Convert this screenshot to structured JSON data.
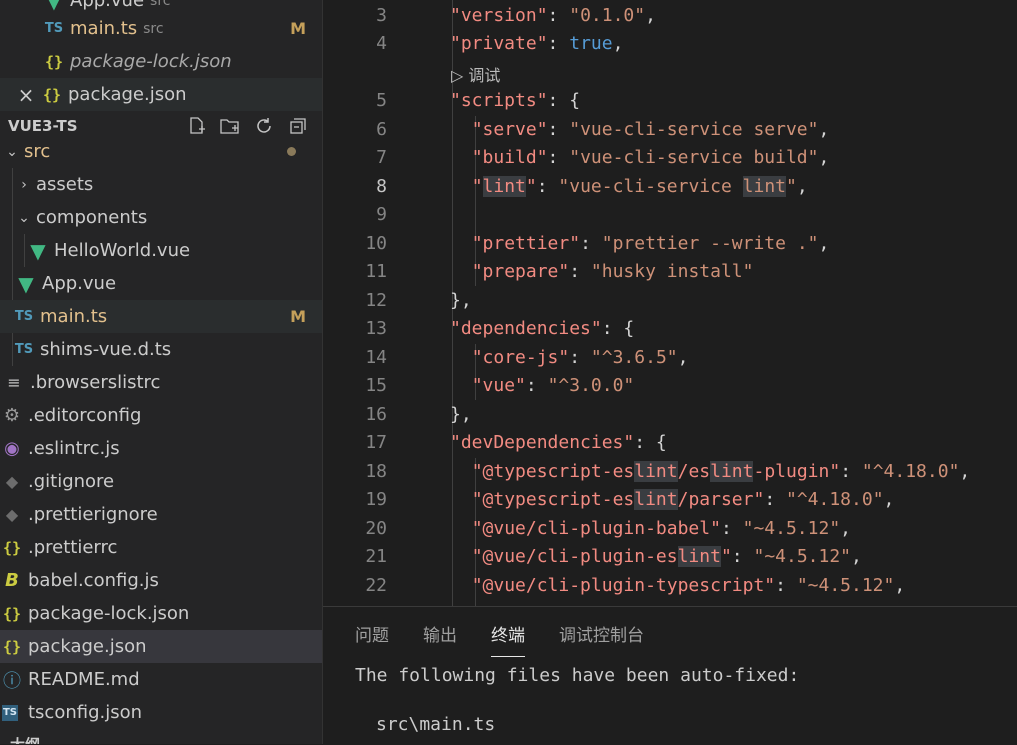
{
  "open_editors": [
    {
      "label": "App.vue",
      "desc": "src",
      "icon": "vue"
    },
    {
      "label": "main.ts",
      "desc": "src",
      "badge": "M",
      "icon": "ts"
    },
    {
      "label": "package-lock.json",
      "icon": "json"
    },
    {
      "label": "package.json",
      "icon": "json",
      "close": "×"
    }
  ],
  "explorer": {
    "title": "VUE3-TS",
    "items": [
      {
        "label": "src",
        "chev": "⌄"
      },
      {
        "label": "assets",
        "chev": "›"
      },
      {
        "label": "components",
        "chev": "⌄"
      },
      {
        "label": "HelloWorld.vue"
      },
      {
        "label": "App.vue"
      },
      {
        "label": "main.ts",
        "badge": "M"
      },
      {
        "label": "shims-vue.d.ts"
      },
      {
        "label": ".browserslistrc"
      },
      {
        "label": ".editorconfig"
      },
      {
        "label": ".eslintrc.js"
      },
      {
        "label": ".gitignore"
      },
      {
        "label": ".prettierignore"
      },
      {
        "label": ".prettierrc"
      },
      {
        "label": "babel.config.js"
      },
      {
        "label": "package-lock.json"
      },
      {
        "label": "package.json"
      },
      {
        "label": "README.md"
      },
      {
        "label": "tsconfig.json"
      }
    ],
    "outline_label": "大纲"
  },
  "editor": {
    "debug_hint": "▷ 调试",
    "lines": [
      {
        "n": "3"
      },
      {
        "n": "4"
      },
      {
        "n": "5"
      },
      {
        "n": "6"
      },
      {
        "n": "7"
      },
      {
        "n": "8"
      },
      {
        "n": "9"
      },
      {
        "n": "10"
      },
      {
        "n": "11"
      },
      {
        "n": "12"
      },
      {
        "n": "13"
      },
      {
        "n": "14"
      },
      {
        "n": "15"
      },
      {
        "n": "16"
      },
      {
        "n": "17"
      },
      {
        "n": "18"
      },
      {
        "n": "19"
      },
      {
        "n": "20"
      },
      {
        "n": "21"
      },
      {
        "n": "22"
      }
    ]
  },
  "panel": {
    "tabs": [
      "问题",
      "输出",
      "终端",
      "调试控制台"
    ],
    "active_tab": "终端",
    "terminal_lines": [
      "The following files have been auto-fixed:",
      "src\\main.ts"
    ]
  }
}
